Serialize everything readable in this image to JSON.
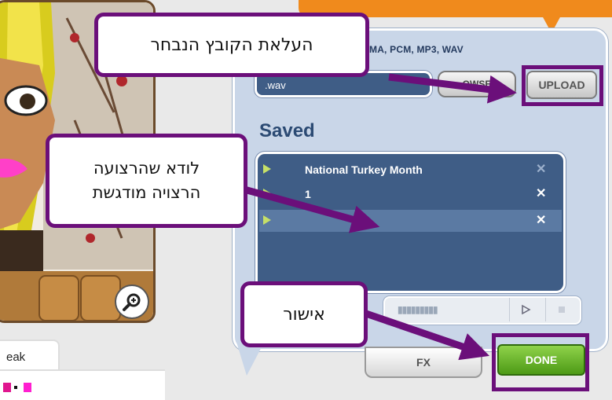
{
  "avatar": {
    "speak_label": "eak"
  },
  "upload": {
    "formats_label": "MA, PCM, MP3, WAV",
    "file_value": ".wav",
    "browse_label": "OWSE",
    "upload_label": "UPLOAD"
  },
  "saved": {
    "title": "Saved",
    "items": [
      {
        "name": "National Turkey Month",
        "selected": false
      },
      {
        "name": "1",
        "selected": false
      },
      {
        "name": "",
        "selected": true
      }
    ]
  },
  "transport": {
    "level_meter": "▮▮▮▮▮▮▮▮▮"
  },
  "buttons": {
    "fx_label": "FX",
    "done_label": "DONE"
  },
  "annotations": {
    "upload_callout": "העלאת הקובץ הנבחר",
    "verify_callout_line1": "לודא שהרצועה",
    "verify_callout_line2": "הרצויה מודגשת",
    "confirm_callout": "אישור"
  },
  "colors": {
    "annotation_purple": "#6b0f7a",
    "panel_blue": "#c9d6e8",
    "list_blue": "#3f5d86",
    "done_green": "#5aa51f",
    "accent_orange": "#f08a1c"
  },
  "icons": [
    "zoom-in-icon",
    "play-icon",
    "stop-icon",
    "delete-icon"
  ]
}
